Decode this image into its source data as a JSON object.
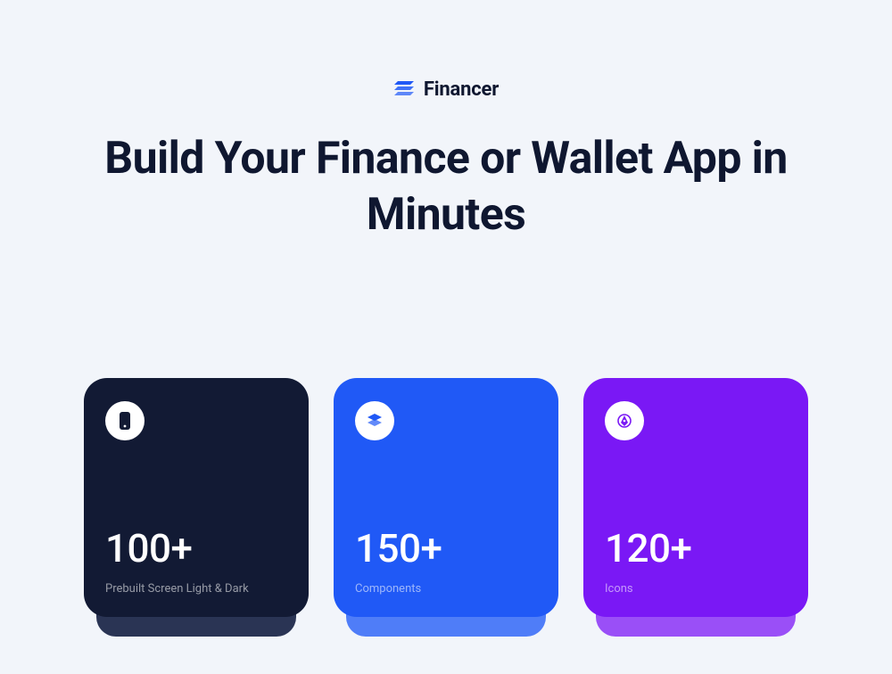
{
  "brand": {
    "name": "Financer"
  },
  "hero": {
    "title": "Build Your Finance or Wallet App in Minutes"
  },
  "cards": [
    {
      "icon": "phone-icon",
      "value": "100+",
      "label": "Prebuilt Screen Light & Dark"
    },
    {
      "icon": "stack-icon",
      "value": "150+",
      "label": "Components"
    },
    {
      "icon": "pen-icon",
      "value": "120+",
      "label": "Icons"
    }
  ],
  "colors": {
    "card0": "#121A34",
    "card1": "#2059F6",
    "card2": "#7A18F5",
    "brandBlue": "#2059F6"
  }
}
